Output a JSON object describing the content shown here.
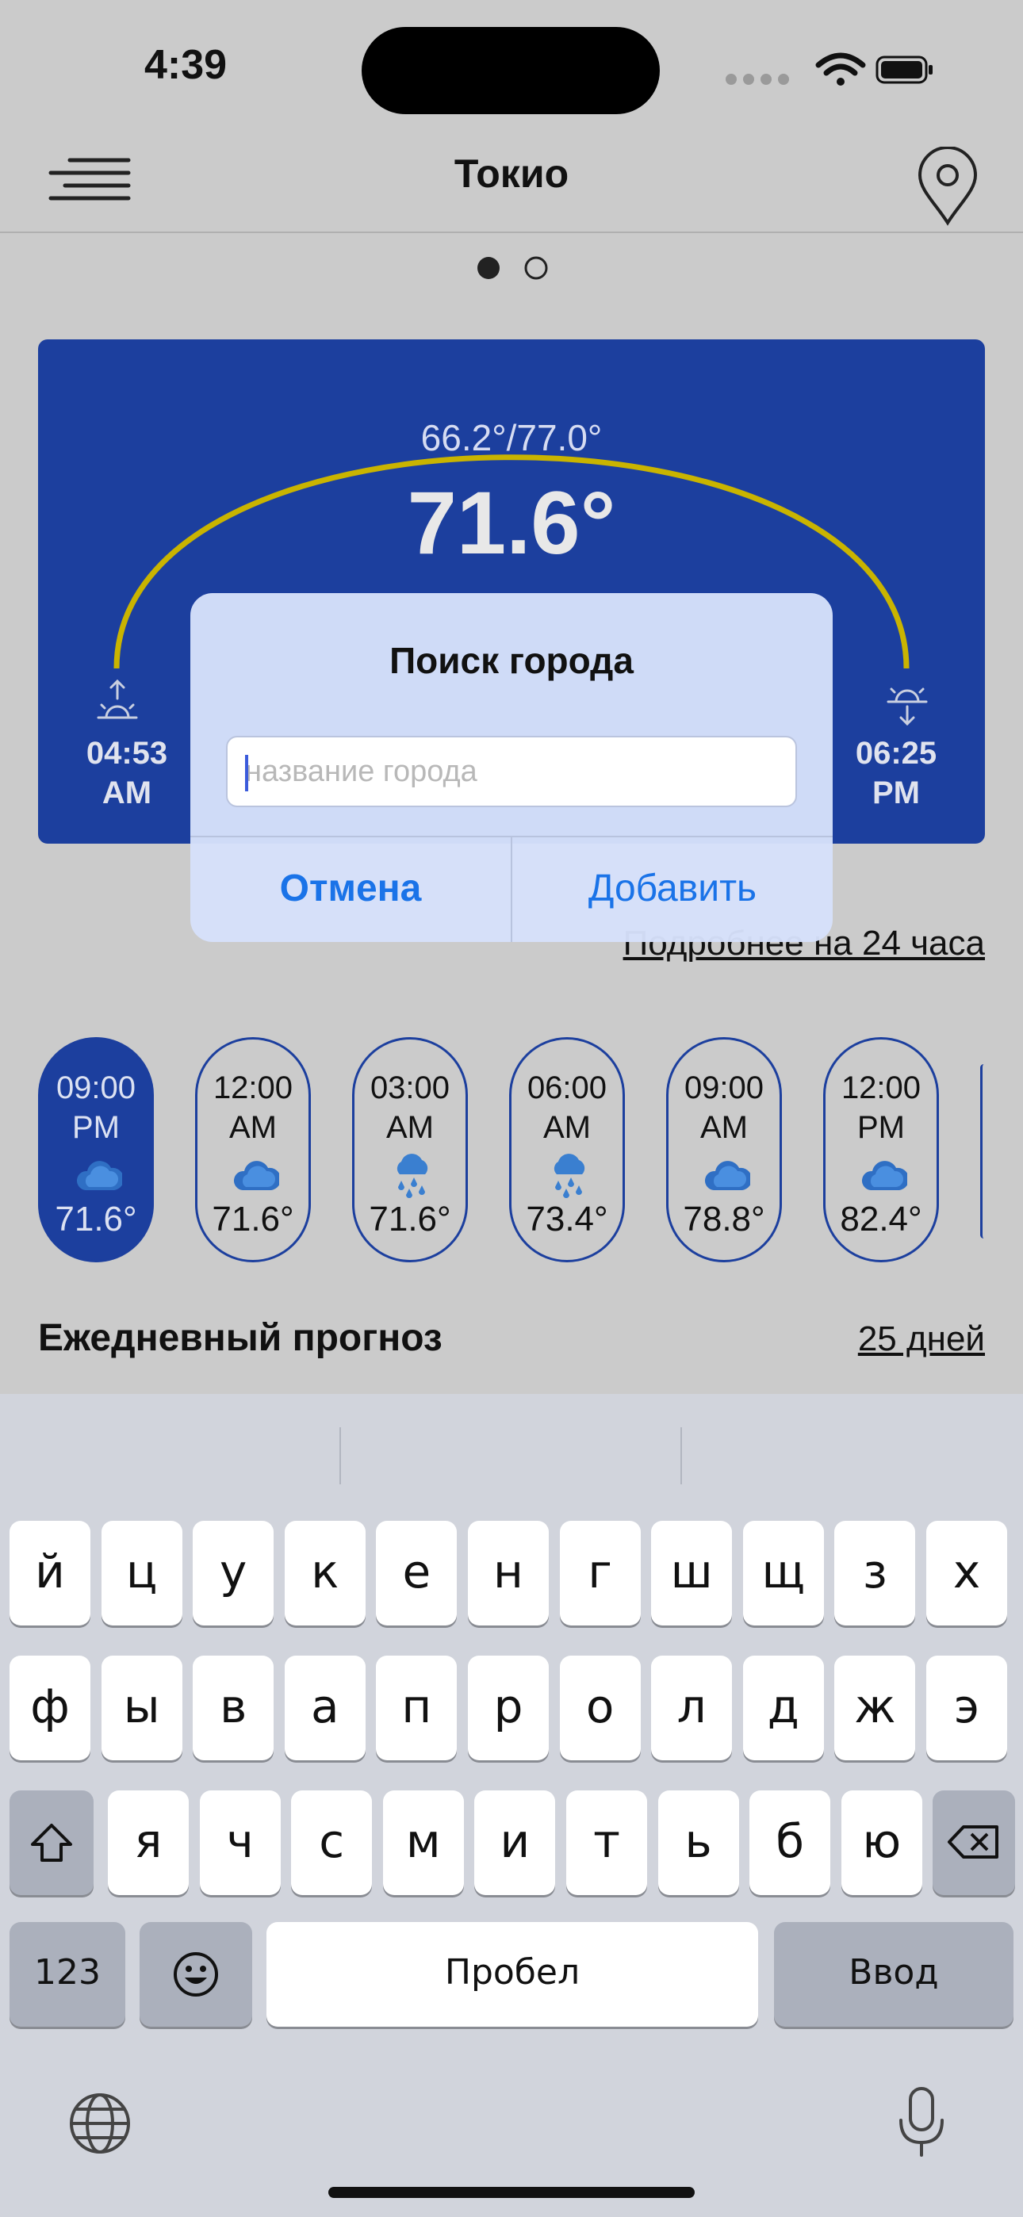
{
  "status_bar": {
    "time": "4:39"
  },
  "header": {
    "title": "Токио"
  },
  "weather_card": {
    "range": "66.2°/77.0°",
    "current_temp": "71.6°",
    "sunrise": {
      "time": "04:53",
      "ampm": "AM"
    },
    "sunset": {
      "time": "06:25",
      "ampm": "PM"
    }
  },
  "details_link": "Подробнее на 24 часа",
  "hourly": [
    {
      "time": "09:00",
      "ampm": "PM",
      "icon": "cloud-icon",
      "temp": "71.6°",
      "active": true
    },
    {
      "time": "12:00",
      "ampm": "AM",
      "icon": "cloud-icon",
      "temp": "71.6°",
      "active": false
    },
    {
      "time": "03:00",
      "ampm": "AM",
      "icon": "rain-icon",
      "temp": "71.6°",
      "active": false
    },
    {
      "time": "06:00",
      "ampm": "AM",
      "icon": "rain-icon",
      "temp": "73.4°",
      "active": false
    },
    {
      "time": "09:00",
      "ampm": "AM",
      "icon": "cloud-icon",
      "temp": "78.8°",
      "active": false
    },
    {
      "time": "12:00",
      "ampm": "PM",
      "icon": "cloud-icon",
      "temp": "82.4°",
      "active": false
    }
  ],
  "daily": {
    "title": "Ежедневный прогноз",
    "link": "25 дней"
  },
  "dialog": {
    "title": "Поиск города",
    "input_placeholder": "название города",
    "input_value": "",
    "cancel_label": "Отмена",
    "add_label": "Добавить"
  },
  "keyboard": {
    "row1": [
      "й",
      "ц",
      "у",
      "к",
      "е",
      "н",
      "г",
      "ш",
      "щ",
      "з",
      "х"
    ],
    "row2": [
      "ф",
      "ы",
      "в",
      "а",
      "п",
      "р",
      "о",
      "л",
      "д",
      "ж",
      "э"
    ],
    "row3": [
      "я",
      "ч",
      "с",
      "м",
      "и",
      "т",
      "ь",
      "б",
      "ю"
    ],
    "numbers_label": "123",
    "space_label": "Пробел",
    "return_label": "Ввод"
  },
  "colors": {
    "card": "#1c3f9e",
    "arc": "#c9b400",
    "link": "#1a73e8"
  }
}
